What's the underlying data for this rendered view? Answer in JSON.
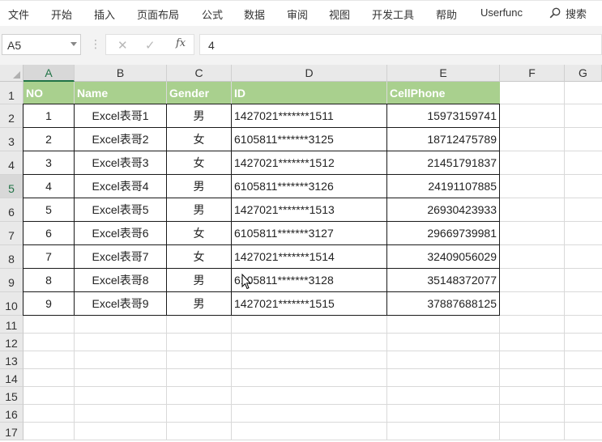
{
  "ribbon": {
    "tabs": [
      "文件",
      "开始",
      "插入",
      "页面布局",
      "公式",
      "数据",
      "审阅",
      "视图",
      "开发工具",
      "帮助",
      "Userfunc"
    ],
    "search_label": "搜索"
  },
  "formula_bar": {
    "name_box": "A5",
    "formula_value": "4",
    "fx_label": "fx"
  },
  "sheet": {
    "columns": [
      "A",
      "B",
      "C",
      "D",
      "E",
      "F",
      "G"
    ],
    "rows": [
      "1",
      "2",
      "3",
      "4",
      "5",
      "6",
      "7",
      "8",
      "9",
      "10",
      "11",
      "12",
      "13",
      "14",
      "15",
      "16",
      "17"
    ],
    "selected_column": "A",
    "selected_row": "5"
  },
  "table": {
    "headers": [
      "NO",
      "Name",
      "Gender",
      "ID",
      "CellPhone"
    ],
    "rows": [
      [
        "1",
        "Excel表哥1",
        "男",
        "1427021*******1511",
        "15973159741"
      ],
      [
        "2",
        "Excel表哥2",
        "女",
        "6105811*******3125",
        "18712475789"
      ],
      [
        "3",
        "Excel表哥3",
        "女",
        "1427021*******1512",
        "21451791837"
      ],
      [
        "4",
        "Excel表哥4",
        "男",
        "6105811*******3126",
        "24191107885"
      ],
      [
        "5",
        "Excel表哥5",
        "男",
        "1427021*******1513",
        "26930423933"
      ],
      [
        "6",
        "Excel表哥6",
        "女",
        "6105811*******3127",
        "29669739981"
      ],
      [
        "7",
        "Excel表哥7",
        "女",
        "1427021*******1514",
        "32409056029"
      ],
      [
        "8",
        "Excel表哥8",
        "男",
        "6105811*******3128",
        "35148372077"
      ],
      [
        "9",
        "Excel表哥9",
        "男",
        "1427021*******1515",
        "37887688125"
      ]
    ]
  },
  "colors": {
    "header_fill": "#a9d08e",
    "accent": "#217346"
  }
}
